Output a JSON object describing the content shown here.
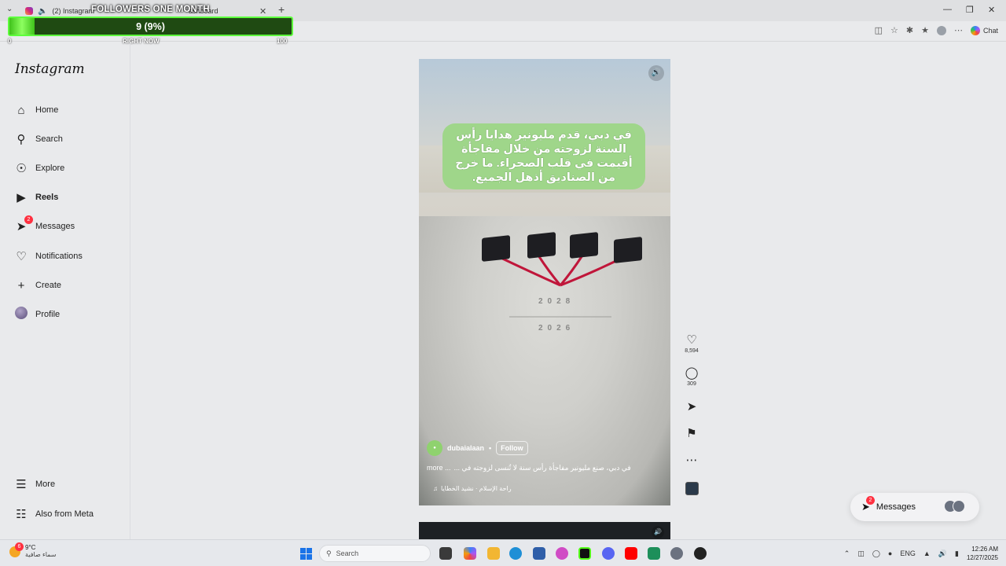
{
  "browser": {
    "tab_active_title": "(2) Instagram",
    "tab_second_title": "ashboard",
    "chat_label": "Chat"
  },
  "followers_overlay": {
    "title": "FOLLOWERS ONE MONTH",
    "value_text": "9 (9%)",
    "progress_fraction": 0.09,
    "min_label": "0",
    "max_label": "100",
    "now_label": "RIGHT NOW"
  },
  "sidebar": {
    "logo": "Instagram",
    "items": [
      {
        "label": "Home",
        "icon": "home-icon"
      },
      {
        "label": "Search",
        "icon": "search-icon"
      },
      {
        "label": "Explore",
        "icon": "compass-icon"
      },
      {
        "label": "Reels",
        "icon": "reels-icon"
      },
      {
        "label": "Messages",
        "icon": "messenger-icon",
        "badge": "2"
      },
      {
        "label": "Notifications",
        "icon": "heart-icon"
      },
      {
        "label": "Create",
        "icon": "plus-icon"
      },
      {
        "label": "Profile",
        "icon": "profile-avatar"
      }
    ],
    "more_label": "More",
    "meta_label": "Also from Meta"
  },
  "reel": {
    "overlay_caption": "في دبي، قدم مليونير هدايا رأس السنة لزوجته من خلال مفاجأة أقيمت في قلب الصحراء. ما خرج من الصناديق أذهل الجميع.",
    "year_top": "2028",
    "year_bottom": "2026",
    "author": "dubaialaan",
    "follow_label": "Follow",
    "description": "في دبي، صنع مليونير مفاجأة رأس سنة لا تُنسى لزوجته في ...",
    "more_label": "more ...",
    "music": "راحة الإسلام · نشيد الخطايا"
  },
  "actions": {
    "likes": "8,594",
    "comments": "309"
  },
  "messages_pill": {
    "label": "Messages",
    "badge": "2"
  },
  "taskbar": {
    "weather_temp": "9°C",
    "weather_desc": "سماء صافية",
    "weather_badge": "6",
    "search_placeholder": "Search",
    "lang": "ENG",
    "time": "12:26 AM",
    "date": "12/27/2025"
  }
}
